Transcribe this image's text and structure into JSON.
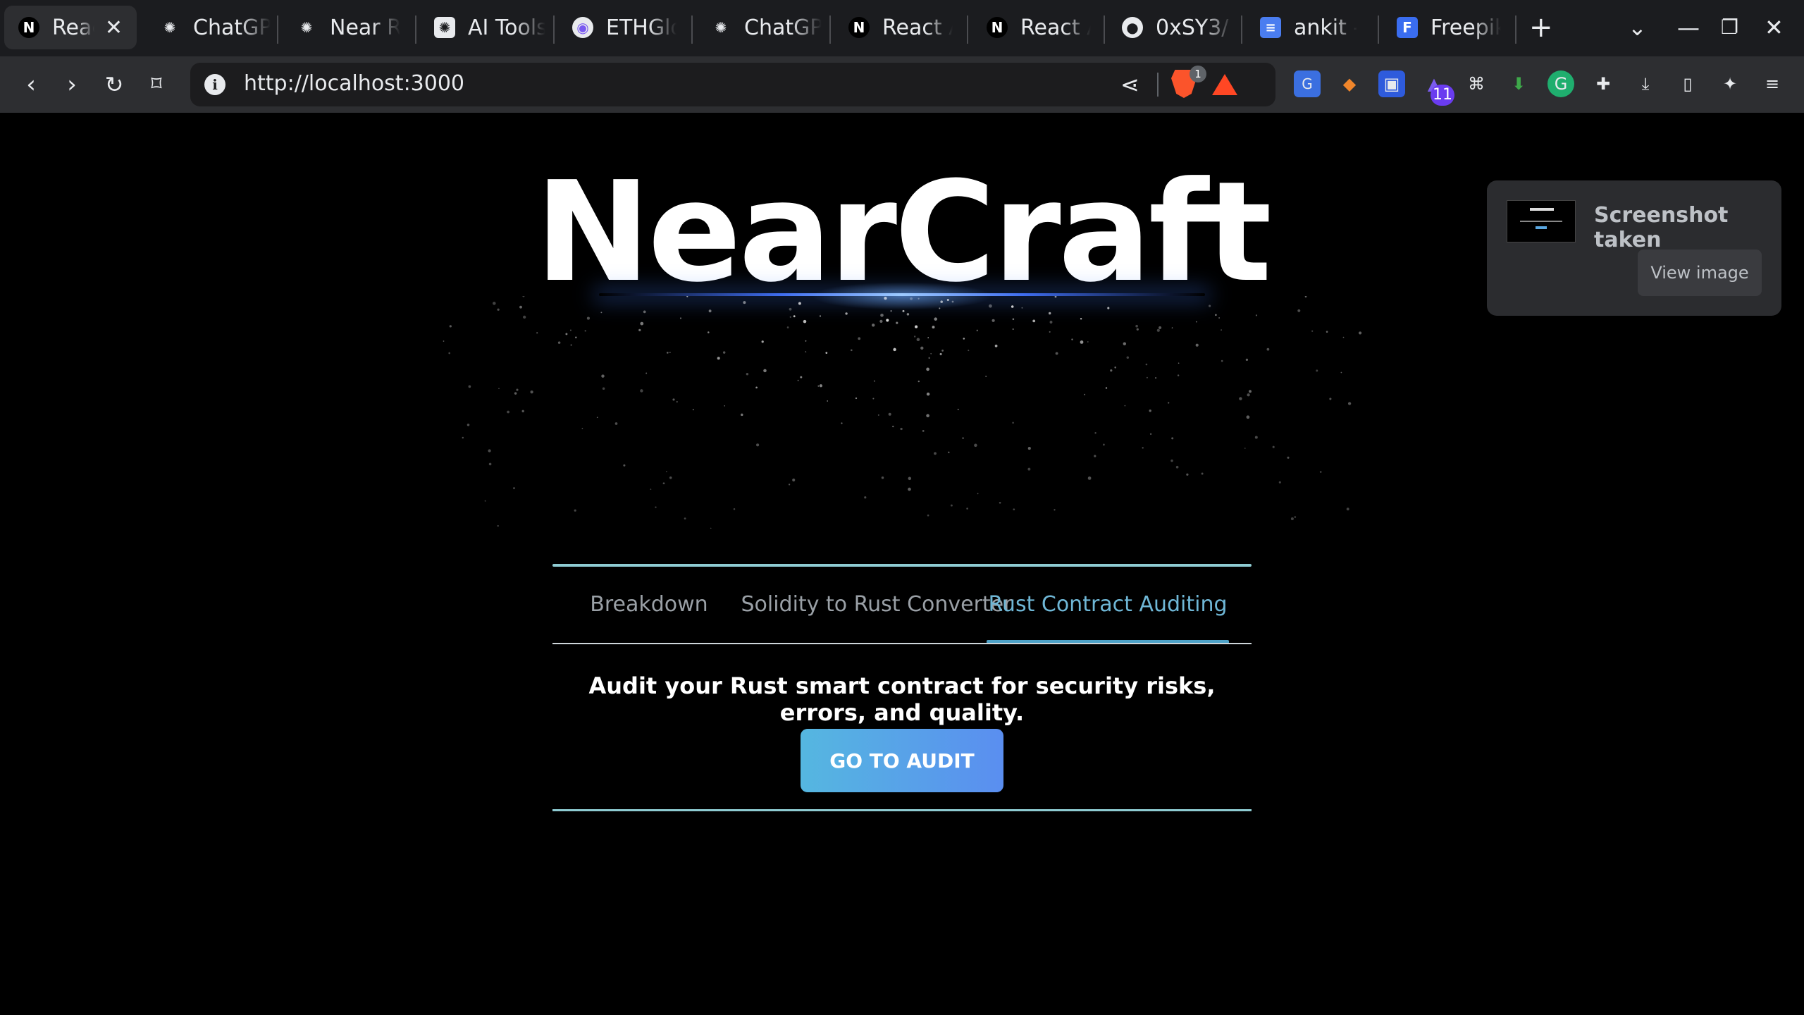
{
  "browser": {
    "tabs": [
      {
        "title": "React App",
        "icon": "next-icon",
        "active": true
      },
      {
        "title": "ChatGPT",
        "icon": "openai-icon"
      },
      {
        "title": "Near Rust",
        "icon": "openai-icon"
      },
      {
        "title": "AI Tools",
        "icon": "openai-icon"
      },
      {
        "title": "ETHGlobal",
        "icon": "ethglobal-icon"
      },
      {
        "title": "ChatGPT",
        "icon": "openai-icon"
      },
      {
        "title": "React App",
        "icon": "next-icon"
      },
      {
        "title": "React App",
        "icon": "next-icon"
      },
      {
        "title": "0xSY3/",
        "icon": "github-icon"
      },
      {
        "title": "ankit - ",
        "icon": "docs-icon"
      },
      {
        "title": "Freepik",
        "icon": "freepik-icon"
      }
    ],
    "address_bar": {
      "url": "http://localhost:3000"
    },
    "brave_shields_count": "1",
    "extension_badge": "11"
  },
  "page": {
    "title": "NearCraft",
    "tabs": [
      {
        "label": "Breakdown",
        "active": false
      },
      {
        "label": "Solidity to Rust Converter",
        "active": false
      },
      {
        "label": "Rust Contract Auditing",
        "active": true
      }
    ],
    "description": "Audit your Rust smart contract for security risks, errors, and quality.",
    "cta_label": "GO TO AUDIT"
  },
  "toast": {
    "message": "Screenshot taken",
    "action_label": "View image"
  },
  "colors": {
    "background": "#000000",
    "accent": "#4fa3c8",
    "button_gradient_start": "#55b7e0",
    "button_gradient_end": "#5a8ef0",
    "card_border": "#8ecbd2"
  }
}
